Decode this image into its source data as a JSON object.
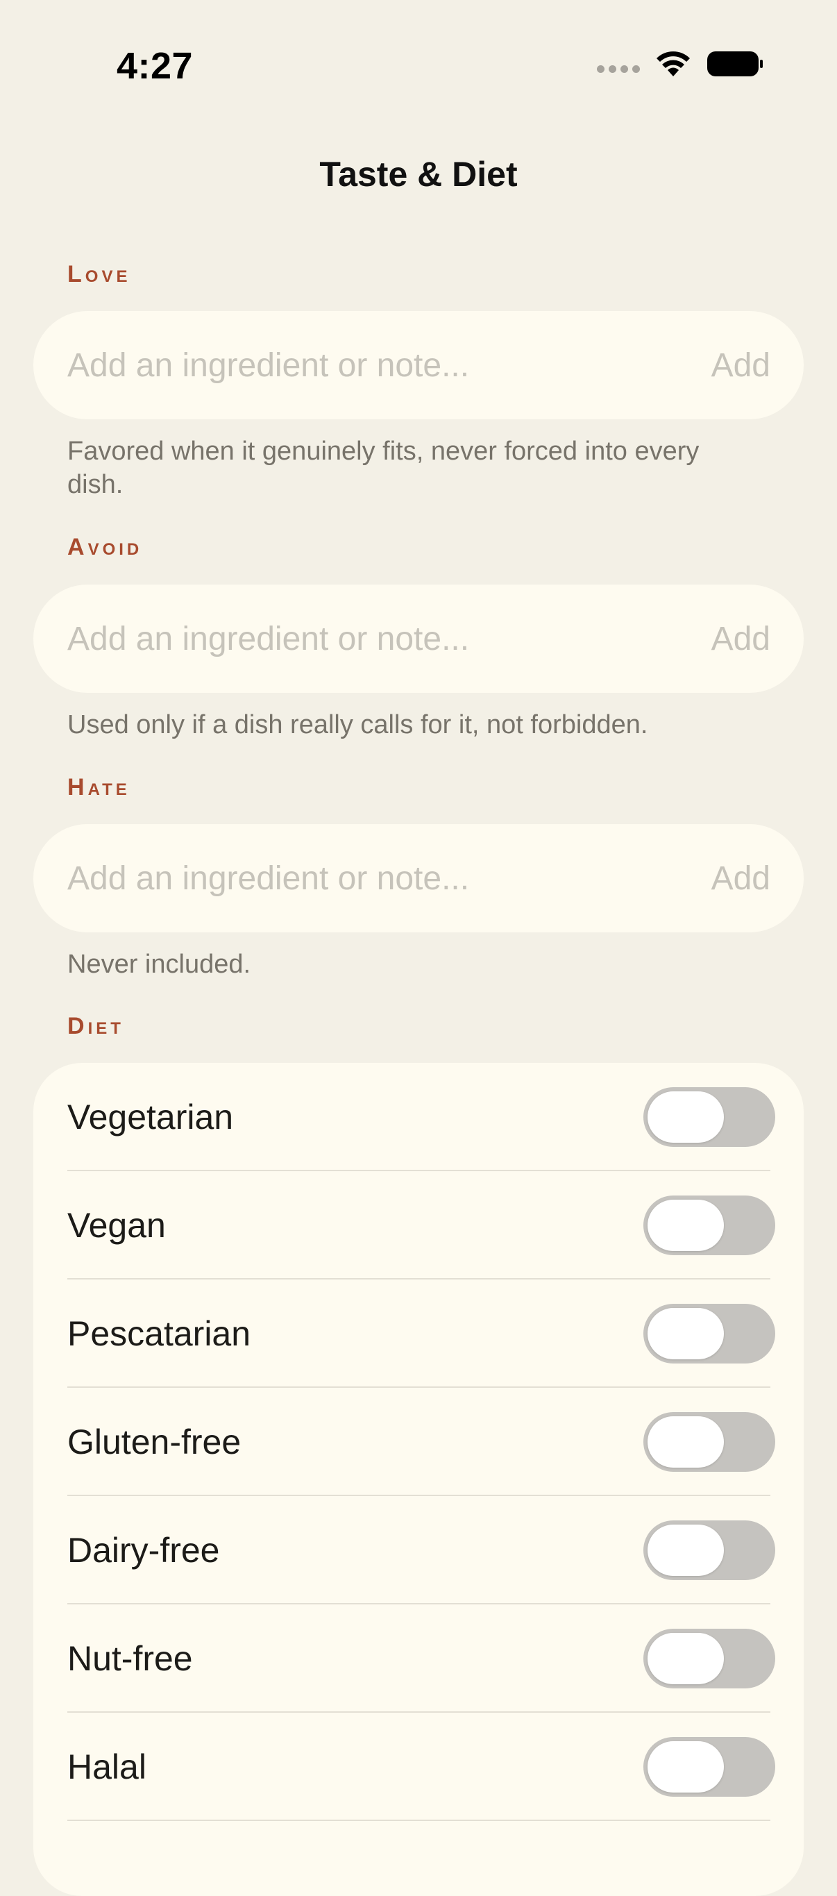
{
  "status_bar": {
    "time": "4:27",
    "icons": [
      "cellular-signal-icon",
      "wifi-icon",
      "battery-icon"
    ]
  },
  "header": {
    "title": "Taste & Diet"
  },
  "sections": {
    "love": {
      "label": "Love",
      "placeholder": "Add an ingredient or note...",
      "add_label": "Add",
      "hint": "Favored when it genuinely fits, never forced into every dish."
    },
    "avoid": {
      "label": "Avoid",
      "placeholder": "Add an ingredient or note...",
      "add_label": "Add",
      "hint": "Used only if a dish really calls for it, not forbidden."
    },
    "hate": {
      "label": "Hate",
      "placeholder": "Add an ingredient or note...",
      "add_label": "Add",
      "hint": "Never included."
    }
  },
  "diet": {
    "label": "Diet",
    "items": [
      {
        "label": "Vegetarian",
        "enabled": false
      },
      {
        "label": "Vegan",
        "enabled": false
      },
      {
        "label": "Pescatarian",
        "enabled": false
      },
      {
        "label": "Gluten-free",
        "enabled": false
      },
      {
        "label": "Dairy-free",
        "enabled": false
      },
      {
        "label": "Nut-free",
        "enabled": false
      },
      {
        "label": "Halal",
        "enabled": false
      }
    ]
  },
  "colors": {
    "background": "#F3F0E6",
    "card": "#FEFBF0",
    "accent": "#A84B2E",
    "hint_text": "#77736A",
    "placeholder": "#C6C3BA",
    "toggle_off": "#C5C3BF"
  }
}
